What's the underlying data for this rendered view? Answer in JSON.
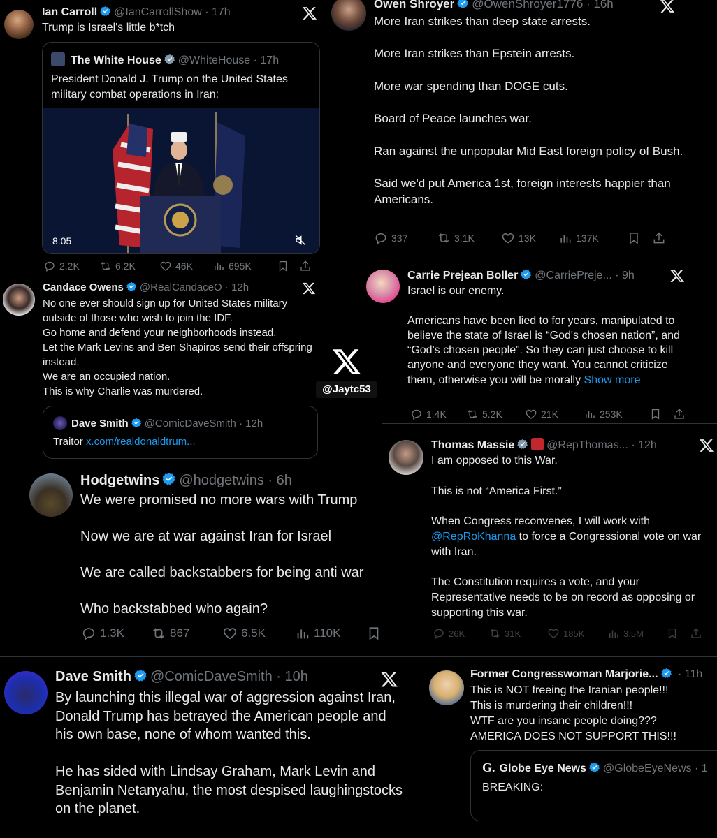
{
  "colors": {
    "background": "#000000",
    "text": "#e7e9ea",
    "muted": "#71767b",
    "link": "#1d9bf0",
    "verified": "#1d9bf0",
    "border": "#2f3336"
  },
  "watermark": {
    "logo": "X",
    "handle": "@Jaytc53"
  },
  "tweets": [
    {
      "name": "Ian Carroll",
      "handle": "@IanCarrollShow",
      "time": "17h",
      "text": "Trump is Israel's little b*tch",
      "quote": {
        "name": "The White House",
        "handle": "@WhiteHouse",
        "time": "17h",
        "text": "President Donald J. Trump on the United States military combat operations in Iran:",
        "video_duration": "8:05"
      },
      "stats": {
        "replies": "2.2K",
        "reposts": "6.2K",
        "likes": "46K",
        "views": "695K"
      }
    },
    {
      "name": "Owen Shroyer",
      "handle": "@OwenShroyer1776",
      "time": "16h",
      "text": "More Iran strikes than deep state arrests.\n\nMore Iran strikes than Epstein arrests.\n\nMore war spending than DOGE cuts.\n\nBoard of Peace launches war.\n\nRan against the unpopular Mid East foreign policy of Bush.\n\nSaid we'd put America 1st, foreign interests happier than Americans.",
      "stats": {
        "replies": "337",
        "reposts": "3.1K",
        "likes": "13K",
        "views": "137K"
      }
    },
    {
      "name": "Candace Owens",
      "handle": "@RealCandaceO",
      "time": "12h",
      "text": "No one ever should sign up for United States military outside of those who wish to join the IDF.\nGo home and defend your neighborhoods instead.\nLet the Mark Levins and Ben Shapiros send their offspring instead.\nWe are an occupied nation.\nThis is why Charlie was murdered.",
      "quote": {
        "name": "Dave Smith",
        "handle": "@ComicDaveSmith",
        "time": "12h",
        "text": "Traitor ",
        "link": "x.com/realdonaldtrum..."
      }
    },
    {
      "name": "Carrie Prejean Boller",
      "handle": "@CarriePreje...",
      "time": "9h",
      "text": "Israel is our enemy.\n\nAmericans have been lied to for years, manipulated to believe the state of Israel is “God's chosen nation”, and “God's chosen people”. So they can just choose to kill anyone and everyone they want. You cannot criticize them, otherwise you will be morally ",
      "show_more": "Show more",
      "stats": {
        "replies": "1.4K",
        "reposts": "5.2K",
        "likes": "21K",
        "views": "253K"
      }
    },
    {
      "name": "Hodgetwins",
      "handle": "@hodgetwins",
      "time": "6h",
      "text": "We were promised no more wars with Trump\n\nNow we are at war against Iran for Israel\n\nWe are called backstabbers for being anti war\n\nWho backstabbed who again?",
      "stats": {
        "replies": "1.3K",
        "reposts": "867",
        "likes": "6.5K",
        "views": "110K"
      }
    },
    {
      "name": "Thomas Massie",
      "handle": "@RepThomas...",
      "time": "12h",
      "text_before": "I am opposed to this War.\n\nThis is not “America First.”\n\nWhen Congress reconvenes, I will work with ",
      "mention": "@RepRoKhanna",
      "text_after": " to force a Congressional vote on war with Iran.\n\nThe Constitution requires a vote, and your Representative needs to be on record as opposing or supporting this war.",
      "stats": {
        "replies": "26K",
        "reposts": "31K",
        "likes": "185K",
        "views": "3.5M"
      }
    },
    {
      "name": "Dave Smith",
      "handle": "@ComicDaveSmith",
      "time": "10h",
      "text": "By launching this illegal war of aggression against Iran, Donald Trump has betrayed the American people and his own base, none of whom wanted this.\n\nHe has sided with Lindsay Graham, Mark Levin and Benjamin Netanyahu, the most despised laughingstocks on the planet."
    },
    {
      "name": "Former Congresswoman Marjorie...",
      "handle": "",
      "time": "11h",
      "text": "This is NOT freeing the Iranian people!!!\nThis is murdering their children!!!\nWTF are you insane people doing???\nAMERICA DOES NOT SUPPORT THIS!!!",
      "quote": {
        "name": "Globe Eye News",
        "handle": "@GlobeEyeNews",
        "time": "1",
        "text": "BREAKING:"
      }
    }
  ]
}
